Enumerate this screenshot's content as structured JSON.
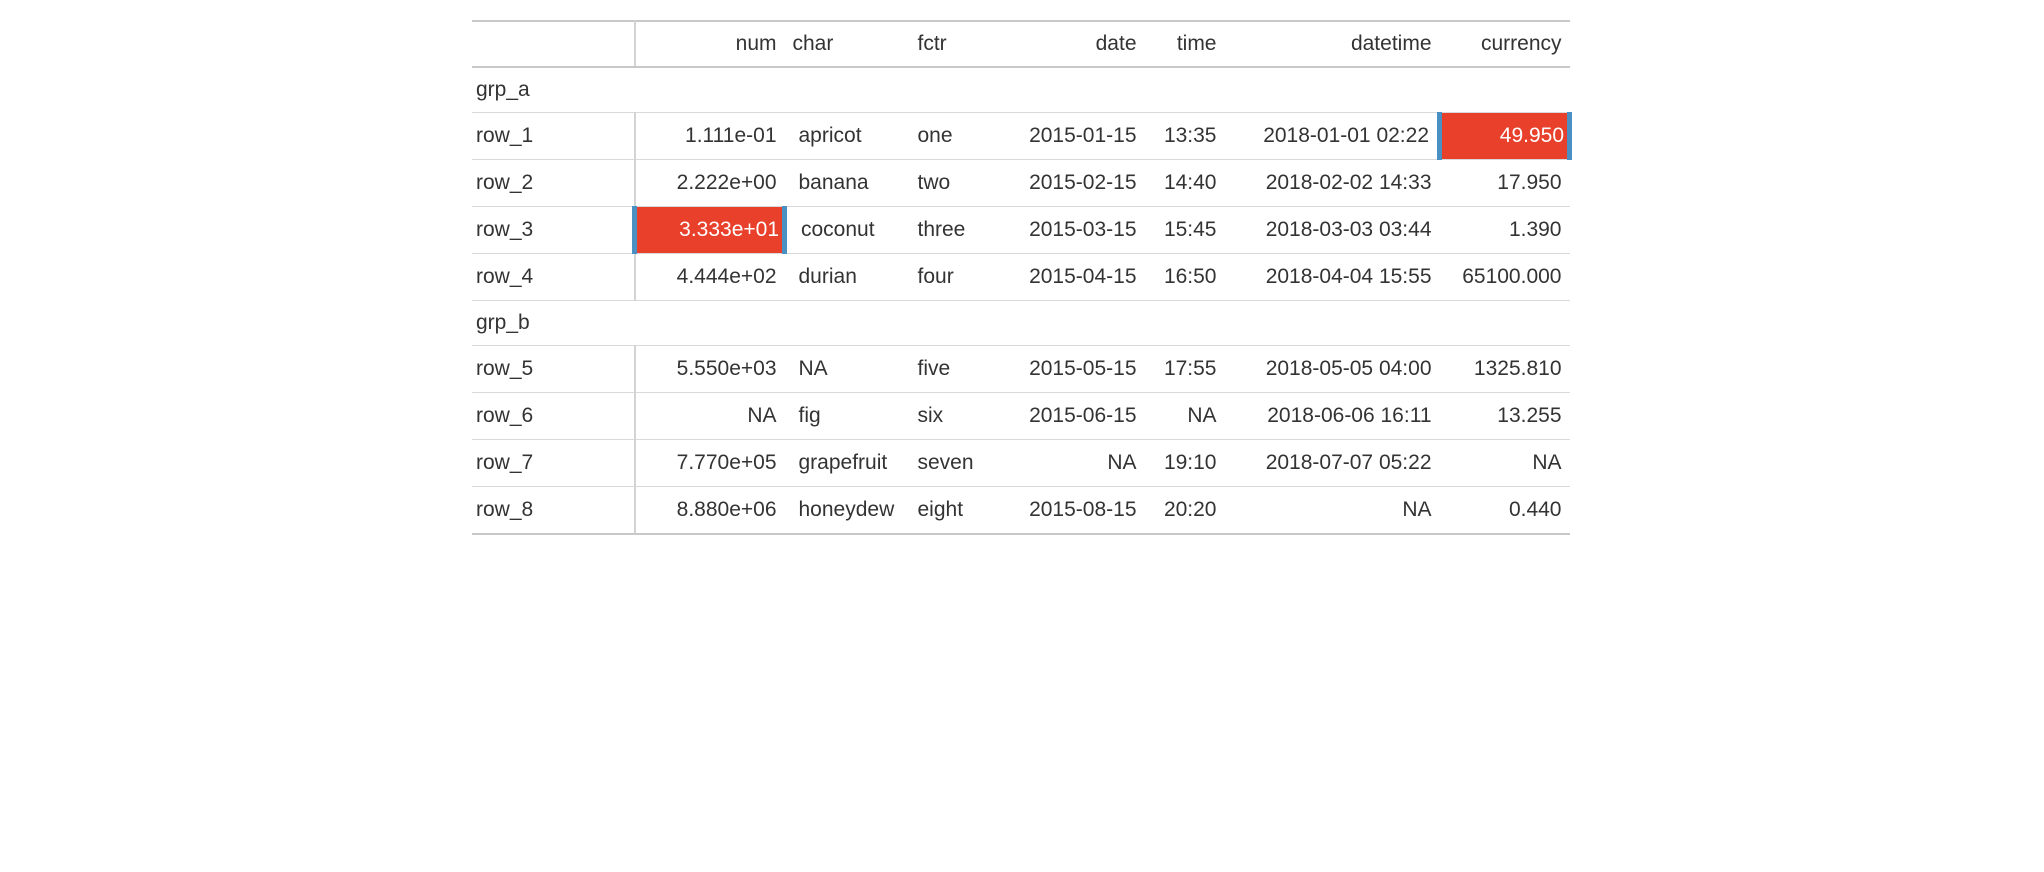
{
  "table": {
    "headers": {
      "stub": "",
      "num": "num",
      "char": "char",
      "fctr": "fctr",
      "date": "date",
      "time": "time",
      "datetime": "datetime",
      "currency": "currency"
    },
    "groups": [
      {
        "label": "grp_a",
        "rows": [
          {
            "stub": "row_1",
            "num": "1.111e-01",
            "char": "apricot",
            "fctr": "one",
            "date": "2015-01-15",
            "time": "13:35",
            "datetime": "2018-01-01 02:22",
            "currency": "49.950",
            "hl_num": false,
            "hl_currency": true
          },
          {
            "stub": "row_2",
            "num": "2.222e+00",
            "char": "banana",
            "fctr": "two",
            "date": "2015-02-15",
            "time": "14:40",
            "datetime": "2018-02-02 14:33",
            "currency": "17.950",
            "hl_num": false,
            "hl_currency": false
          },
          {
            "stub": "row_3",
            "num": "3.333e+01",
            "char": "coconut",
            "fctr": "three",
            "date": "2015-03-15",
            "time": "15:45",
            "datetime": "2018-03-03 03:44",
            "currency": "1.390",
            "hl_num": true,
            "hl_currency": false
          },
          {
            "stub": "row_4",
            "num": "4.444e+02",
            "char": "durian",
            "fctr": "four",
            "date": "2015-04-15",
            "time": "16:50",
            "datetime": "2018-04-04 15:55",
            "currency": "65100.000",
            "hl_num": false,
            "hl_currency": false
          }
        ]
      },
      {
        "label": "grp_b",
        "rows": [
          {
            "stub": "row_5",
            "num": "5.550e+03",
            "char": "NA",
            "fctr": "five",
            "date": "2015-05-15",
            "time": "17:55",
            "datetime": "2018-05-05 04:00",
            "currency": "1325.810",
            "hl_num": false,
            "hl_currency": false
          },
          {
            "stub": "row_6",
            "num": "NA",
            "char": "fig",
            "fctr": "six",
            "date": "2015-06-15",
            "time": "NA",
            "datetime": "2018-06-06 16:11",
            "currency": "13.255",
            "hl_num": false,
            "hl_currency": false
          },
          {
            "stub": "row_7",
            "num": "7.770e+05",
            "char": "grapefruit",
            "fctr": "seven",
            "date": "NA",
            "time": "19:10",
            "datetime": "2018-07-07 05:22",
            "currency": "NA",
            "hl_num": false,
            "hl_currency": false
          },
          {
            "stub": "row_8",
            "num": "8.880e+06",
            "char": "honeydew",
            "fctr": "eight",
            "date": "2015-08-15",
            "time": "20:20",
            "datetime": "NA",
            "currency": "0.440",
            "hl_num": false,
            "hl_currency": false
          }
        ]
      }
    ]
  },
  "colors": {
    "highlight_bg": "#e8402a",
    "highlight_border": "#4a90c2"
  }
}
